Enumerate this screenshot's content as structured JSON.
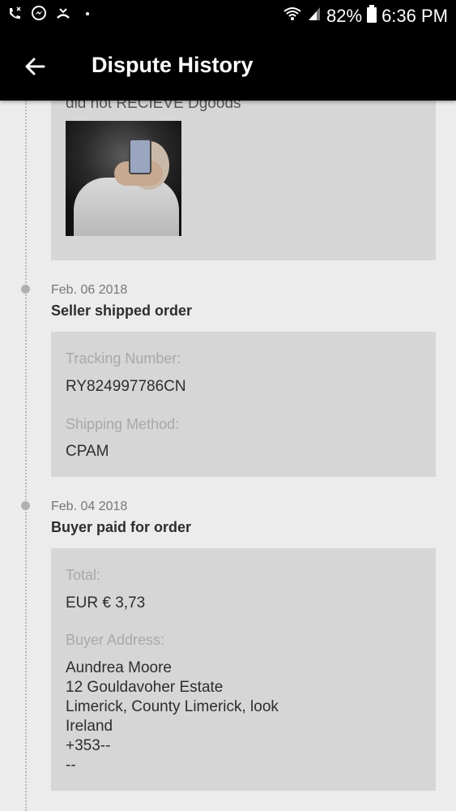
{
  "status_bar": {
    "battery": "82%",
    "time": "6:36 PM",
    "icons": [
      "missed-call-icon",
      "messenger-icon",
      "phone-missed-icon",
      "dot-icon",
      "wifi-icon",
      "signal-icon",
      "battery-icon"
    ]
  },
  "appbar": {
    "title": "Dispute History",
    "back_icon": "arrow-left-icon"
  },
  "events": [
    {
      "note": "did not RECIEVE Dgoods",
      "photo": "attached-photo"
    },
    {
      "date": "Feb. 06 2018",
      "title": "Seller shipped order",
      "fields": [
        {
          "label": "Tracking Number:",
          "value": "RY824997786CN"
        },
        {
          "label": "Shipping Method:",
          "value": "CPAM"
        }
      ]
    },
    {
      "date": "Feb. 04 2018",
      "title": "Buyer paid for order",
      "total_label": "Total:",
      "total_value": "EUR € 3,73",
      "address_label": "Buyer Address:",
      "address_lines": [
        "Aundrea Moore",
        "12 Gouldavoher Estate",
        "Limerick, County Limerick, look",
        "Ireland",
        "+353--",
        "--"
      ]
    }
  ],
  "colors": {
    "appbar": "#000000",
    "background": "#ececec",
    "card": "#d6d6d6"
  }
}
